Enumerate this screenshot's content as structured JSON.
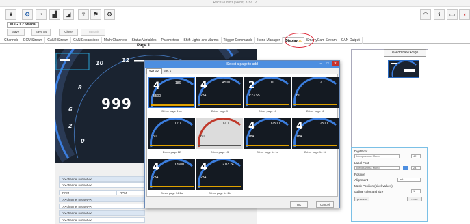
{
  "window": {
    "title": "RaceStudio3 (64 bit) 3.32.12"
  },
  "toolbar": {
    "icons": [
      "star-icon",
      "wrench-icon",
      "speedometer-icon",
      "chart-icon",
      "transmit-icon",
      "upload-icon",
      "flag-icon",
      "settings-icon",
      "wifi-icon",
      "info-icon",
      "hdd-icon",
      "brand-logo-icon"
    ]
  },
  "doc_tab": {
    "label": "MXG 1.2 Strada"
  },
  "doc_buttons": {
    "save": "Save",
    "save_as": "Save As",
    "close": "Close",
    "transmit": "Transmit"
  },
  "tabs": [
    "Channels",
    "ECU Stream",
    "CAN2 Stream",
    "CAN Expansions",
    "Math Channels",
    "Status Variables",
    "Parameters",
    "Shift Lights and Alarms",
    "Trigger Commands",
    "Icons Manager",
    "Display",
    "SmartyCam Stream",
    "CAN Output"
  ],
  "page": {
    "title": "Page 1",
    "big_value": "999"
  },
  "gauge_labels": [
    "10",
    "12",
    "8",
    "6",
    "2",
    "0"
  ],
  "channels": {
    "not_set": ">> channel not set <<",
    "rpm": "RPM"
  },
  "right": {
    "add_page": "Add New Page",
    "digit_font": "Digit Font",
    "label_font": "Label Font",
    "position": "Position",
    "alignment": "Alignment",
    "align_value": "left",
    "mask_position": "Mask Position (pixel values)",
    "outline": "outline color and size",
    "preview": "preview",
    "reset": "reset",
    "digit_size": "42",
    "label_size": "24",
    "outline_value": "1",
    "font_name": "Ideogramma Mono"
  },
  "dialog": {
    "title": "Select a page to add",
    "set_tabs": [
      "Set Ico",
      "Set 1"
    ],
    "ok": "OK",
    "cancel": "Cancel",
    "cells": [
      {
        "caption": "Driver page 5 co",
        "big": "4",
        "sub": "5500",
        "sub2": "186"
      },
      {
        "caption": "Driver page 9",
        "big": "4",
        "sub": "234",
        "sub2": "4500"
      },
      {
        "caption": "Driver page 10",
        "big": "2",
        "sub": "1:23.55",
        "sub2": "10"
      },
      {
        "caption": "Driver page 11",
        "big": "",
        "sub": "80",
        "sub2": "12.7"
      },
      {
        "caption": "Driver page 12",
        "big": "",
        "sub": "80",
        "sub2": "12.7"
      },
      {
        "caption": "Driver page 13",
        "big": "",
        "sub": "80",
        "sub2": "12.7"
      },
      {
        "caption": "Driver page 14 1a",
        "big": "4",
        "sub": "184",
        "sub2": "12500"
      },
      {
        "caption": "Driver page 14 1b",
        "big": "4",
        "sub": "184",
        "sub2": "12500"
      },
      {
        "caption": "Driver page 14 2a",
        "big": "4",
        "sub": "234",
        "sub2": "13500"
      },
      {
        "caption": "Driver page 14 2b",
        "big": "4",
        "sub": "234",
        "sub2": "2.03.24"
      }
    ]
  },
  "colors": {
    "accent": "#4d8ee0",
    "dash_bg": "#1a2330",
    "highlight": "#d23"
  }
}
